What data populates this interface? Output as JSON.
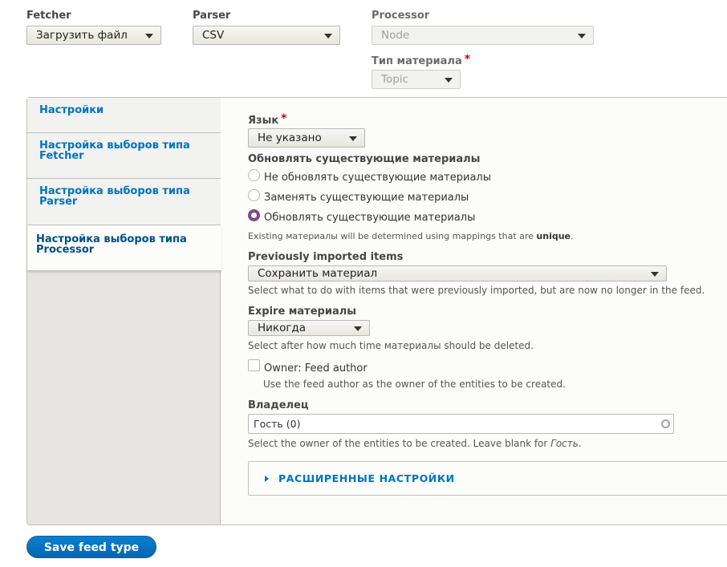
{
  "plugins": {
    "fetcher": {
      "label": "Fetcher",
      "value": "Загрузить файл"
    },
    "parser": {
      "label": "Parser",
      "value": "CSV"
    },
    "processor": {
      "label": "Processor",
      "value": "Node",
      "disabled": true
    },
    "content_type": {
      "label": "Тип материала",
      "required_mark": "*",
      "value": "Topic",
      "disabled": true
    }
  },
  "tabs": [
    {
      "label": "Настройки",
      "active": false
    },
    {
      "label": "Настройка выборов типа Fetcher",
      "active": false
    },
    {
      "label": "Настройка выборов типа Parser",
      "active": false
    },
    {
      "label": "Настройка выборов типа Processor",
      "active": true
    }
  ],
  "processor_settings": {
    "language": {
      "label": "Язык",
      "required_mark": "*",
      "value": "Не указано"
    },
    "update_existing": {
      "label": "Обновлять существующие материалы",
      "options": [
        {
          "label": "Не обновлять существующие материалы",
          "checked": false
        },
        {
          "label": "Заменять существующие материалы",
          "checked": false
        },
        {
          "label": "Обновлять существующие материалы",
          "checked": true
        }
      ],
      "description_prefix": "Existing материалы will be determined using mappings that are ",
      "description_bold": "unique",
      "description_suffix": "."
    },
    "previously_imported": {
      "label": "Previously imported items",
      "value": "Сохранить материал",
      "description": "Select what to do with items that were previously imported, but are now no longer in the feed."
    },
    "expire": {
      "label": "Expire материалы",
      "value": "Никогда",
      "description": "Select after how much time материалы should be deleted."
    },
    "owner_feed": {
      "label": "Owner: Feed author",
      "checked": false,
      "description": "Use the feed author as the owner of the entities to be created."
    },
    "owner": {
      "label": "Владелец",
      "value": "Гость (0)",
      "description_prefix": "Select the owner of the entities to be created. Leave blank for ",
      "description_italic": "Гость",
      "description_suffix": "."
    },
    "advanced": {
      "label": "РАСШИРЕННЫЕ НАСТРОЙКИ"
    }
  },
  "actions": {
    "save_label": "Save feed type"
  },
  "colors": {
    "link": "#0074bd",
    "active_tab_text": "#004f80",
    "radio_checked": "#7a4b86",
    "required": "#e00000",
    "primary_button": "#0074bd"
  }
}
